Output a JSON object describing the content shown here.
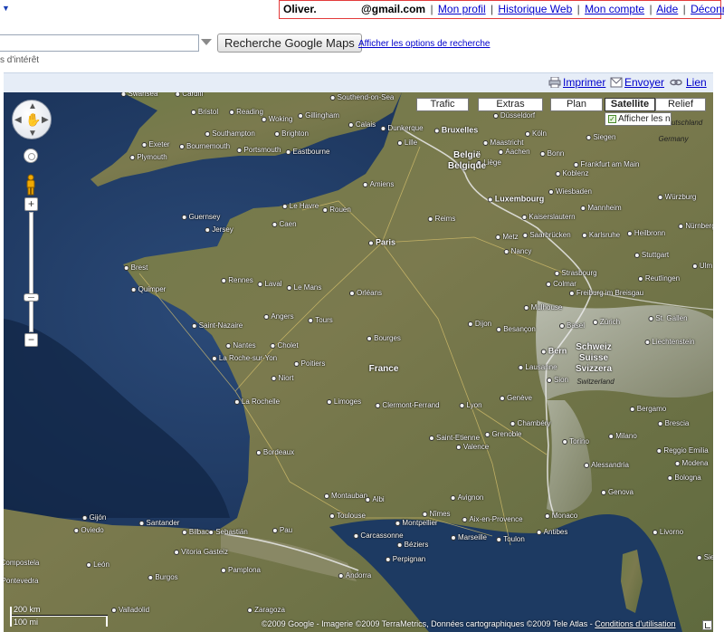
{
  "account": {
    "user": "Oliver.",
    "email": "@gmail.com",
    "links": [
      "Mon profil",
      "Historique Web",
      "Mon compte",
      "Aide",
      "Déconnexion"
    ],
    "separator": "|"
  },
  "search": {
    "value": "",
    "button_label": "Recherche Google Maps",
    "options_link": "Afficher les options de recherche",
    "poi_hint": "s d'intérêt"
  },
  "toolbar": {
    "print": "Imprimer",
    "send": "Envoyer",
    "link": "Lien"
  },
  "map_types": {
    "buttons": [
      "Trafic",
      "Extras",
      "Plan",
      "Satellite",
      "Relief"
    ],
    "active": "Satellite",
    "overlay_checkbox": "Afficher les n",
    "overlay_checked": true
  },
  "map_labels": {
    "countries": [
      "Belgique",
      "België",
      "France",
      "Schweiz",
      "Suisse",
      "Svizzera"
    ],
    "cities": [
      "Swansea",
      "Cardiff",
      "Southend-on-Sea",
      "Bristol",
      "Reading",
      "Woking",
      "Gillingham",
      "Southampton",
      "Portsmouth",
      "Brighton",
      "Eastbourne",
      "Exeter",
      "Bournemouth",
      "Plymouth",
      "Calais",
      "Dunkerque",
      "Lille",
      "Bruxelles",
      "Maastricht",
      "Köln",
      "Düsseldorf",
      "Aachen",
      "Bonn",
      "Liège",
      "Siegen",
      "Frankfurt am Main",
      "Koblenz",
      "Wiesbaden",
      "Mannheim",
      "Würzburg",
      "Nürnberg",
      "Luxembourg",
      "Kaiserslautern",
      "Heilbronn",
      "Saarbrücken",
      "Karlsruhe",
      "Stuttgart",
      "Ulm",
      "Le Havre",
      "Rouen",
      "Caen",
      "Amiens",
      "Reims",
      "Metz",
      "Nancy",
      "Paris",
      "Guernsey",
      "Jersey",
      "Brest",
      "Rennes",
      "Laval",
      "Le Mans",
      "Orléans",
      "Tours",
      "Quimper",
      "Saint-Nazaire",
      "Nantes",
      "Angers",
      "Cholet",
      "Strasbourg",
      "Colmar",
      "Freiburg im Breisgau",
      "Reutlingen",
      "Dijon",
      "Besançon",
      "Mulhouse",
      "Basel",
      "Zürich",
      "St. Gallen",
      "Liechtenstein",
      "Bern",
      "Bourges",
      "La Roche-sur-Yon",
      "Poitiers",
      "Niort",
      "La Rochelle",
      "Limoges",
      "Clermont-Ferrand",
      "Lyon",
      "Lausanne",
      "Genève",
      "Chambéry",
      "Grenoble",
      "Saint-Etienne",
      "Valence",
      "Bergamo",
      "Brescia",
      "Milano",
      "Torino",
      "Alessandria",
      "Reggio Emilia",
      "Modena",
      "Bologna",
      "Bordeaux",
      "Montauban",
      "Albi",
      "Toulouse",
      "Avignon",
      "Nîmes",
      "Montpellier",
      "Aix-en-Provence",
      "Marseille",
      "Toulon",
      "Antibes",
      "Monaco",
      "Genova",
      "Livorno",
      "Gijón",
      "Oviedo",
      "Santander",
      "Bilbao",
      "Sebastián",
      "Pau",
      "Carcassonne",
      "Béziers",
      "Perpignan",
      "Andorra",
      "Vitoria Gasteiz",
      "Pamplona",
      "León",
      "Burgos",
      "Zaragoza",
      "Valladolid",
      "Compostela",
      "Pontevedra",
      "Siena",
      "Germany",
      "Switzerland",
      "Deutschland",
      "Sion"
    ],
    "sea": []
  },
  "scale": {
    "km": "200 km",
    "mi": "100 mi"
  },
  "copyright": {
    "text": "©2009 Google - Imagerie ©2009 TerraMetrics, Données cartographiques ©2009 Tele Atlas -",
    "terms": "Conditions d'utilisation"
  },
  "colors": {
    "link": "#0000cc",
    "highlight_border": "#e33b3b",
    "mapbar_bg": "#e6edf7",
    "sea": "#1d3457",
    "land": "#6e7a4a"
  }
}
